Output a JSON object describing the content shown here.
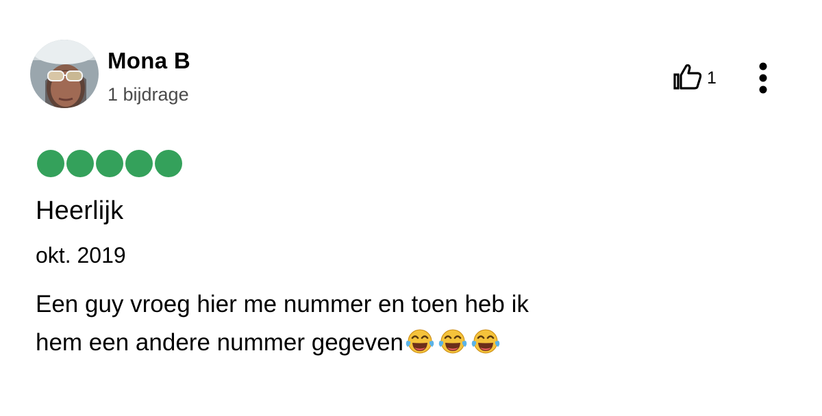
{
  "user": {
    "name": "Mona B",
    "contributions": "1 bijdrage"
  },
  "actions": {
    "helpful_count": "1",
    "helpful_icon": "thumbs-up-icon",
    "menu_icon": "vertical-dots-icon"
  },
  "review": {
    "rating": 5,
    "rating_max": 5,
    "rating_color": "#34a15b",
    "title": "Heerlijk",
    "date": "okt. 2019",
    "body_line_1": "Een guy vroeg hier me nummer en toen heb ik",
    "body_line_2": "hem een andere nummer gegeven",
    "emoji": "face-with-tears-of-joy-icon",
    "emoji_count": 3
  }
}
